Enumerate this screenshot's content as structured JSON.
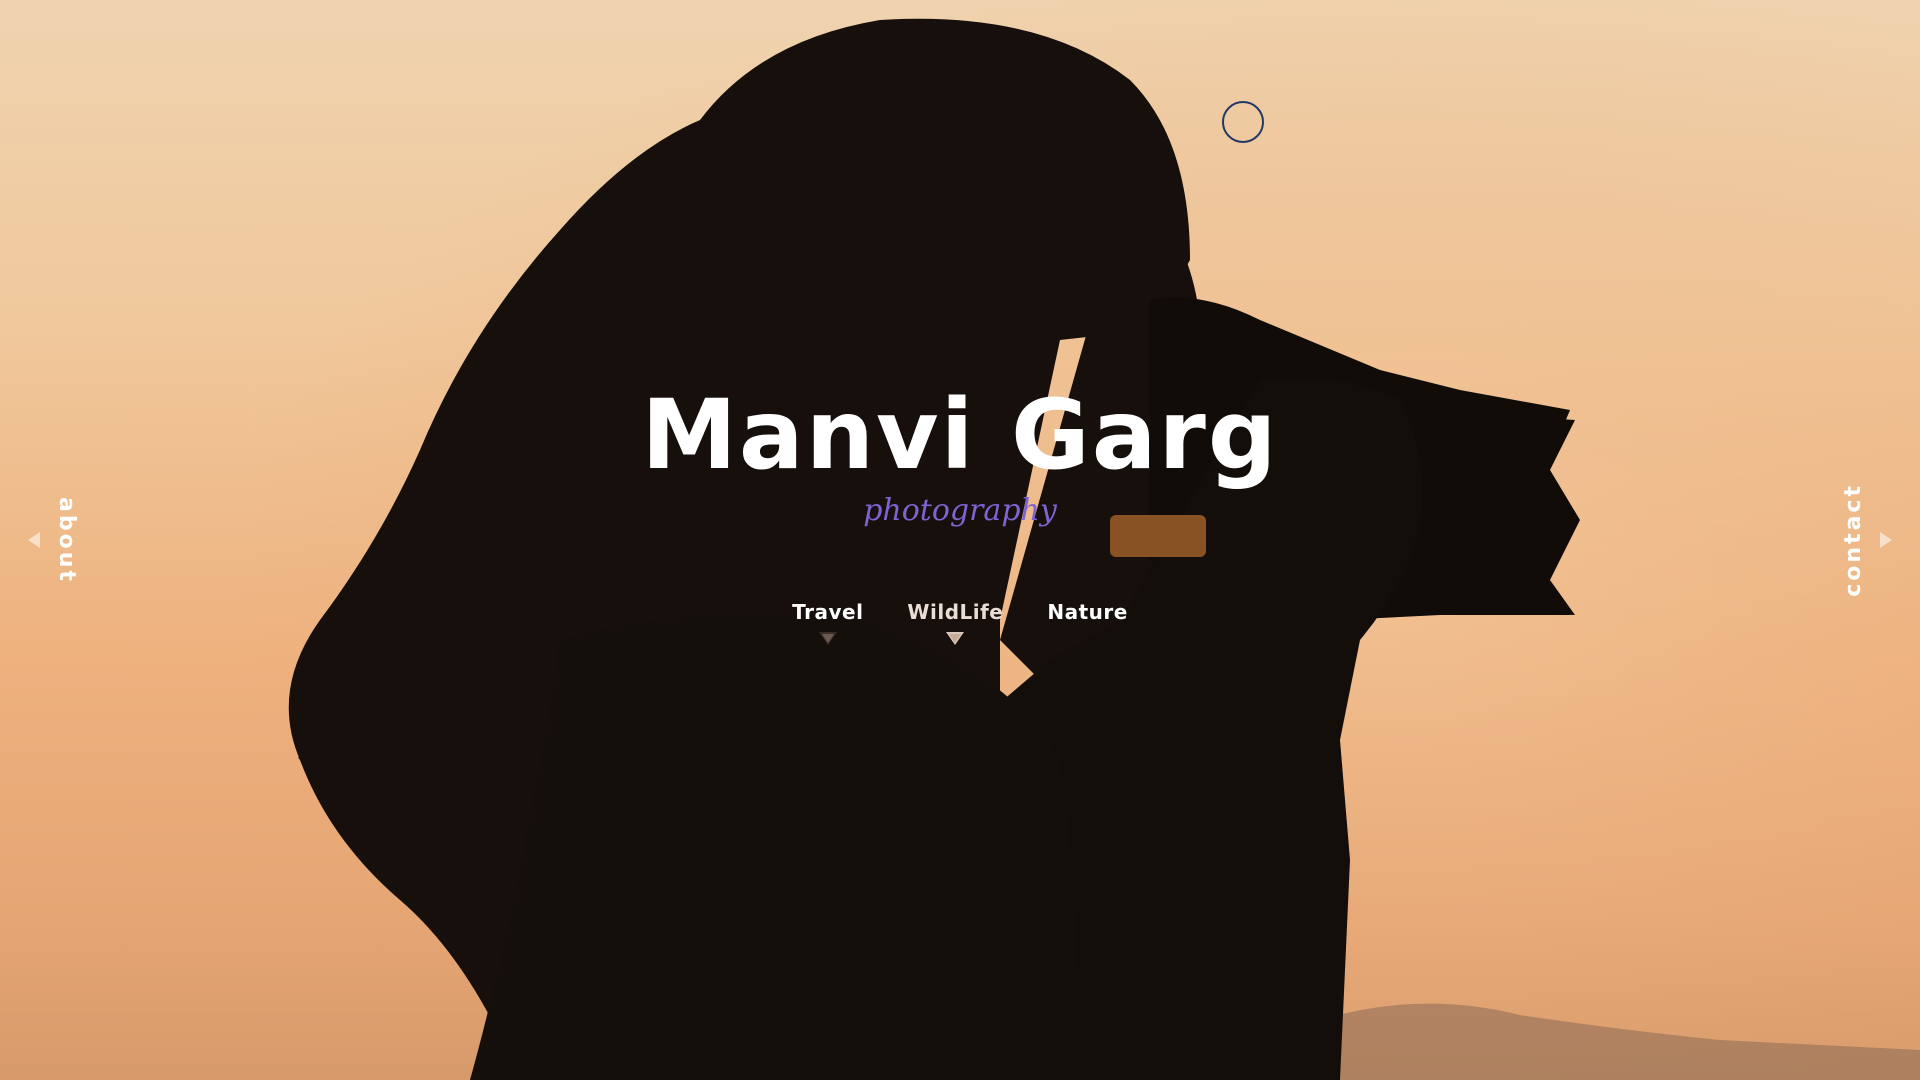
{
  "colors": {
    "sky_top": "#efd3af",
    "sky_bottom": "#d79a6a",
    "silhouette": "#140f0c",
    "brand_name": "#ffffff",
    "tagline": "#7f63d2",
    "cursor_ring": "#223a63"
  },
  "brand": {
    "name": "Manvi Garg",
    "tagline": "photography"
  },
  "nav": {
    "items": [
      {
        "label": "Travel"
      },
      {
        "label": "WildLife"
      },
      {
        "label": "Nature"
      }
    ]
  },
  "side_links": {
    "left": {
      "label": "about",
      "icon": "triangle-left-icon"
    },
    "right": {
      "label": "contact",
      "icon": "triangle-right-icon"
    }
  },
  "hero": {
    "image": "woman-photographer-silhouette-sunset"
  },
  "cursor": {
    "icon": "circle-cursor-icon"
  }
}
